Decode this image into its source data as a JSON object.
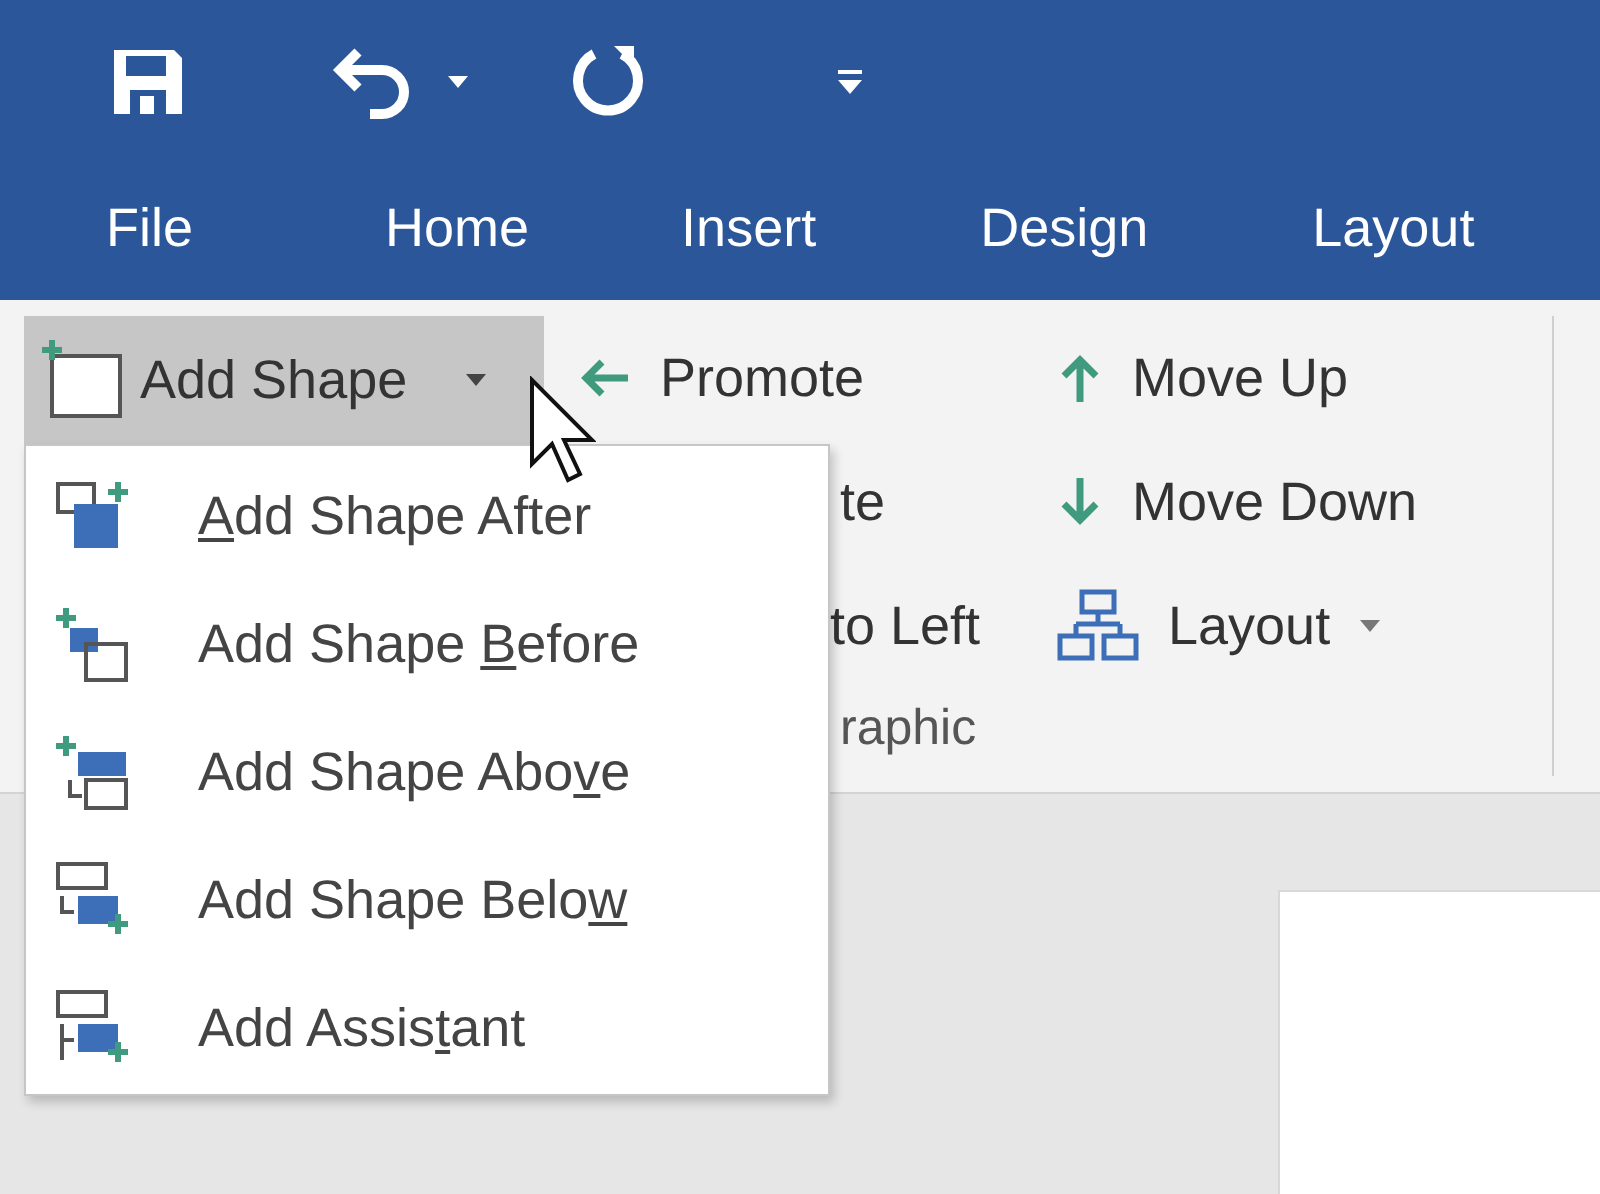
{
  "tabs": [
    {
      "label": "File"
    },
    {
      "label": "Home"
    },
    {
      "label": "Insert"
    },
    {
      "label": "Design"
    },
    {
      "label": "Layout"
    }
  ],
  "ribbon": {
    "add_shape": {
      "label": "Add Shape",
      "expanded": true
    },
    "column_2": [
      {
        "kind": "promote",
        "label": "Promote"
      },
      {
        "kind": "partial",
        "label": "te"
      },
      {
        "kind": "partial",
        "label": "to Left"
      }
    ],
    "group_label": "raphic",
    "column_3": [
      {
        "kind": "move_up",
        "label": "Move Up",
        "dropdown": false
      },
      {
        "kind": "move_down",
        "label": "Move Down",
        "dropdown": false
      },
      {
        "kind": "layout",
        "label": "Layout",
        "dropdown": true
      }
    ]
  },
  "menu": {
    "items": [
      {
        "kind": "after",
        "label_parts": [
          {
            "text": "A",
            "underlined": true
          },
          {
            "text": "dd Shape After",
            "underlined": false
          }
        ]
      },
      {
        "kind": "before",
        "label_parts": [
          {
            "text": "Add Shape ",
            "underlined": false
          },
          {
            "text": "B",
            "underlined": true
          },
          {
            "text": "efore",
            "underlined": false
          }
        ]
      },
      {
        "kind": "above",
        "label_parts": [
          {
            "text": "Add Shape Abo",
            "underlined": false
          },
          {
            "text": "v",
            "underlined": true
          },
          {
            "text": "e",
            "underlined": false
          }
        ]
      },
      {
        "kind": "below",
        "label_parts": [
          {
            "text": "Add Shape Belo",
            "underlined": false
          },
          {
            "text": "w",
            "underlined": true
          }
        ]
      },
      {
        "kind": "assistant",
        "label_parts": [
          {
            "text": "Add Assis",
            "underlined": false
          },
          {
            "text": "t",
            "underlined": true
          },
          {
            "text": "ant",
            "underlined": false
          }
        ]
      }
    ]
  }
}
